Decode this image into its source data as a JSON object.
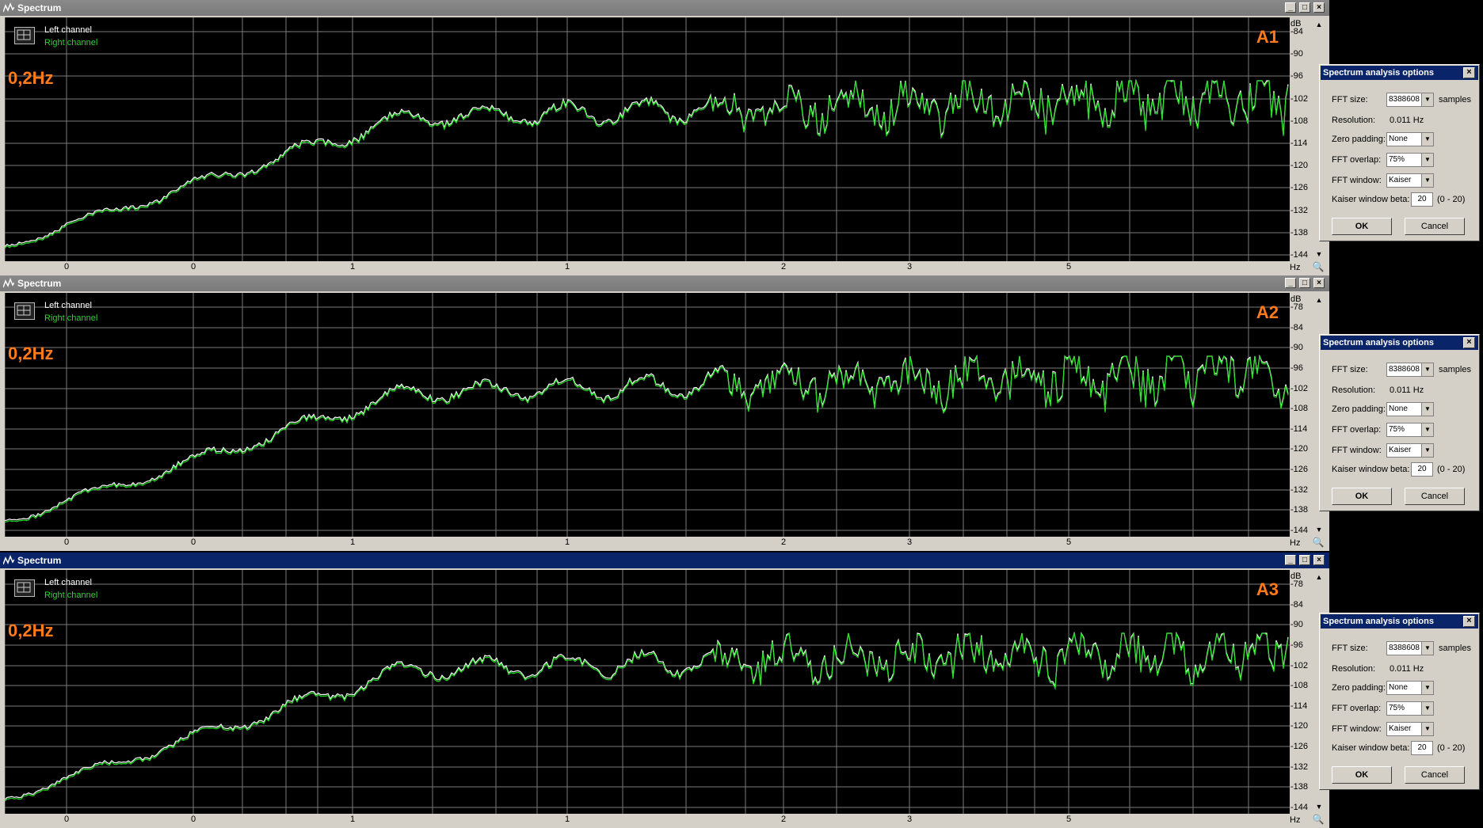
{
  "colors": {
    "left_channel": "#ffffff",
    "right_channel": "#22dd22",
    "annotation": "#ff7a1a",
    "grid": "#7a7a7a"
  },
  "panels": [
    {
      "title": "Spectrum",
      "active": false,
      "legend": {
        "left": "Left channel",
        "right": "Right channel"
      },
      "frequency_note": "0,2Hz",
      "panel_label": "A1",
      "db_unit": "dB",
      "db_ticks": [
        "-84",
        "-90",
        "-96",
        "-102",
        "-108",
        "-114",
        "-120",
        "-126",
        "-132",
        "-138",
        "-144"
      ],
      "hz_unit": "Hz",
      "x_ticks": [
        "0",
        "0",
        "1",
        "1",
        "2",
        "3",
        "5"
      ]
    },
    {
      "title": "Spectrum",
      "active": false,
      "legend": {
        "left": "Left channel",
        "right": "Right channel"
      },
      "frequency_note": "0,2Hz",
      "panel_label": "A2",
      "db_unit": "dB",
      "db_ticks": [
        "-78",
        "-84",
        "-90",
        "-96",
        "-102",
        "-108",
        "-114",
        "-120",
        "-126",
        "-132",
        "-138",
        "-144"
      ],
      "hz_unit": "Hz",
      "x_ticks": [
        "0",
        "0",
        "1",
        "1",
        "2",
        "3",
        "5"
      ]
    },
    {
      "title": "Spectrum",
      "active": true,
      "legend": {
        "left": "Left channel",
        "right": "Right channel"
      },
      "frequency_note": "0,2Hz",
      "panel_label": "A3",
      "db_unit": "dB",
      "db_ticks": [
        "-78",
        "-84",
        "-90",
        "-96",
        "-102",
        "-108",
        "-114",
        "-120",
        "-126",
        "-132",
        "-138",
        "-144"
      ],
      "hz_unit": "Hz",
      "x_ticks": [
        "0",
        "0",
        "1",
        "1",
        "2",
        "3",
        "5"
      ]
    }
  ],
  "dialogs": [
    {
      "title": "Spectrum analysis options",
      "fft_size_label": "FFT size:",
      "fft_size_value": "8388608",
      "fft_size_unit": "samples",
      "resolution_label": "Resolution:",
      "resolution_value": "0.011 Hz",
      "zero_padding_label": "Zero padding:",
      "zero_padding_value": "None",
      "fft_overlap_label": "FFT overlap:",
      "fft_overlap_value": "75%",
      "fft_window_label": "FFT window:",
      "fft_window_value": "Kaiser",
      "beta_label": "Kaiser window beta:",
      "beta_value": "20",
      "beta_range": "(0 - 20)",
      "ok": "OK",
      "cancel": "Cancel"
    },
    {
      "title": "Spectrum analysis options",
      "fft_size_label": "FFT size:",
      "fft_size_value": "8388608",
      "fft_size_unit": "samples",
      "resolution_label": "Resolution:",
      "resolution_value": "0.011 Hz",
      "zero_padding_label": "Zero padding:",
      "zero_padding_value": "None",
      "fft_overlap_label": "FFT overlap:",
      "fft_overlap_value": "75%",
      "fft_window_label": "FFT window:",
      "fft_window_value": "Kaiser",
      "beta_label": "Kaiser window beta:",
      "beta_value": "20",
      "beta_range": "(0 - 20)",
      "ok": "OK",
      "cancel": "Cancel"
    },
    {
      "title": "Spectrum analysis options",
      "fft_size_label": "FFT size:",
      "fft_size_value": "8388608",
      "fft_size_unit": "samples",
      "resolution_label": "Resolution:",
      "resolution_value": "0.011 Hz",
      "zero_padding_label": "Zero padding:",
      "zero_padding_value": "None",
      "fft_overlap_label": "FFT overlap:",
      "fft_overlap_value": "75%",
      "fft_window_label": "FFT window:",
      "fft_window_value": "Kaiser",
      "beta_label": "Kaiser window beta:",
      "beta_value": "20",
      "beta_range": "(0 - 20)",
      "ok": "OK",
      "cancel": "Cancel"
    }
  ]
}
